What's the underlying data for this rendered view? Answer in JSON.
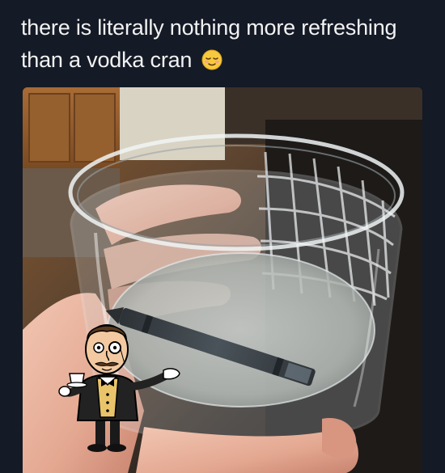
{
  "post": {
    "caption": "there is literally nothing more refreshing than a vodka cran",
    "caption_emoji": "relieved-face-emoji"
  },
  "photo": {
    "subject": "hand holding glass of water with crayon inside"
  },
  "overlay": {
    "sticker": "butler-mascot-sticker"
  },
  "colors": {
    "background": "#141a26",
    "caption_text": "#f2f2f2",
    "emoji_yellow": "#f7c93e"
  }
}
